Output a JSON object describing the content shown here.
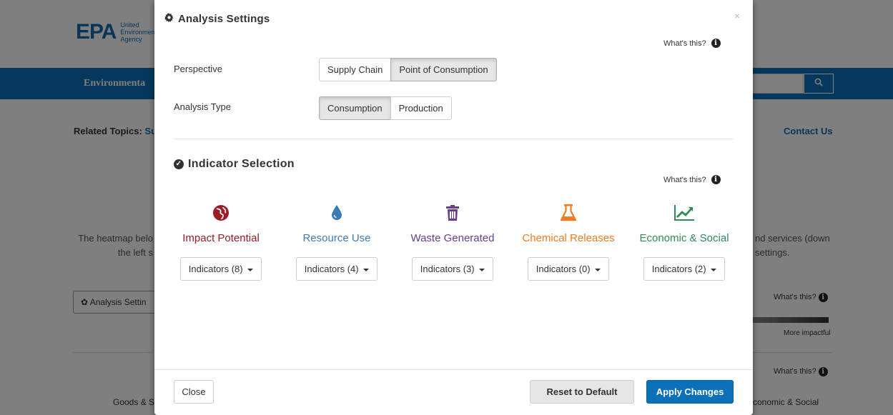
{
  "background": {
    "logo": "EPA",
    "logo_sub": [
      "United",
      "Environmental",
      "Agency"
    ],
    "nav_text": "Environmenta",
    "search_placeholder": "V",
    "related_label": "Related Topics:",
    "related_link": "Su",
    "contact": "Contact Us",
    "intro_left": "The heatmap belo the left s",
    "intro_right": "nd services (down settings.",
    "analysis_btn": "Analysis Settin",
    "whats_this_1": "What's this?",
    "whats_this_2": "What's this?",
    "more_impactful": "More impactful",
    "goods": "Goods & S",
    "economic_social": "conomic & Social"
  },
  "modal": {
    "title": "Analysis Settings",
    "close_glyph": "×",
    "whats_this": "What's this?",
    "perspective": {
      "label": "Perspective",
      "options": [
        "Supply Chain",
        "Point of Consumption"
      ],
      "selected": "Point of Consumption"
    },
    "analysis_type": {
      "label": "Analysis Type",
      "options": [
        "Consumption",
        "Production"
      ],
      "selected": "Consumption"
    },
    "indicator_selection": {
      "title": "Indicator Selection",
      "whats_this": "What's this?",
      "categories": [
        {
          "label": "Impact Potential",
          "icon": "globe-icon",
          "color": "#9b1c24",
          "dropdown": "Indicators (8)"
        },
        {
          "label": "Resource Use",
          "icon": "droplet-icon",
          "color": "#3d7bb5",
          "dropdown": "Indicators (4)"
        },
        {
          "label": "Waste Generated",
          "icon": "trash-icon",
          "color": "#6a3d8c",
          "dropdown": "Indicators (3)"
        },
        {
          "label": "Chemical Releases",
          "icon": "flask-icon",
          "color": "#ee7c22",
          "dropdown": "Indicators (0)"
        },
        {
          "label": "Economic & Social",
          "icon": "line-chart-icon",
          "color": "#2e8b57",
          "dropdown": "Indicators (2)"
        }
      ]
    },
    "footer": {
      "close": "Close",
      "reset": "Reset to Default",
      "apply": "Apply Changes"
    }
  }
}
